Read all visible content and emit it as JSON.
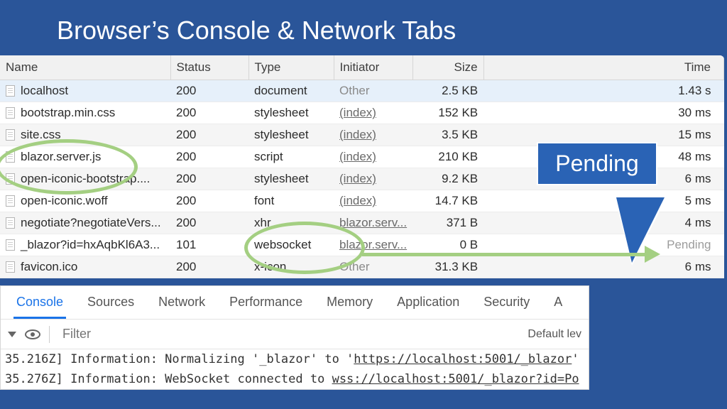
{
  "title": "Browser’s Console & Network Tabs",
  "columns": [
    "Name",
    "Status",
    "Type",
    "Initiator",
    "Size",
    "Time"
  ],
  "rows": [
    {
      "name": "localhost",
      "status": "200",
      "type": "document",
      "initiator": "Other",
      "initType": "other",
      "size": "2.5 KB",
      "time": "1.43 s",
      "sel": true
    },
    {
      "name": "bootstrap.min.css",
      "status": "200",
      "type": "stylesheet",
      "initiator": "(index)",
      "initType": "link",
      "size": "152 KB",
      "time": "30 ms"
    },
    {
      "name": "site.css",
      "status": "200",
      "type": "stylesheet",
      "initiator": "(index)",
      "initType": "link",
      "size": "3.5 KB",
      "time": "15 ms"
    },
    {
      "name": "blazor.server.js",
      "status": "200",
      "type": "script",
      "initiator": "(index)",
      "initType": "link",
      "size": "210 KB",
      "time": "48 ms"
    },
    {
      "name": "open-iconic-bootstrap....",
      "status": "200",
      "type": "stylesheet",
      "initiator": "(index)",
      "initType": "link",
      "size": "9.2 KB",
      "time": "6 ms"
    },
    {
      "name": "open-iconic.woff",
      "status": "200",
      "type": "font",
      "initiator": "(index)",
      "initType": "link",
      "size": "14.7 KB",
      "time": "5 ms"
    },
    {
      "name": "negotiate?negotiateVers...",
      "status": "200",
      "type": "xhr",
      "initiator": "blazor.serv...",
      "initType": "link",
      "size": "371 B",
      "time": "4 ms"
    },
    {
      "name": "_blazor?id=hxAqbKl6A3...",
      "status": "101",
      "type": "websocket",
      "initiator": "blazor.serv...",
      "initType": "link",
      "size": "0 B",
      "time": "Pending",
      "pending": true
    },
    {
      "name": "favicon.ico",
      "status": "200",
      "type": "x-icon",
      "initiator": "Other",
      "initType": "other",
      "size": "31.3 KB",
      "time": "6 ms"
    }
  ],
  "tabs": [
    "Console",
    "Sources",
    "Network",
    "Performance",
    "Memory",
    "Application",
    "Security",
    "A"
  ],
  "activeTab": "Console",
  "filter": {
    "placeholder": "Filter",
    "levels": "Default lev"
  },
  "logs": [
    {
      "prefix": "35.216Z] Information: Normalizing '_blazor' to '",
      "link": "https://localhost:5001/_blazor",
      "suffix": "'"
    },
    {
      "prefix": "35.276Z] Information: WebSocket connected to ",
      "link": "wss://localhost:5001/_blazor?id=Po",
      "suffix": ""
    }
  ],
  "callout": "Pending"
}
